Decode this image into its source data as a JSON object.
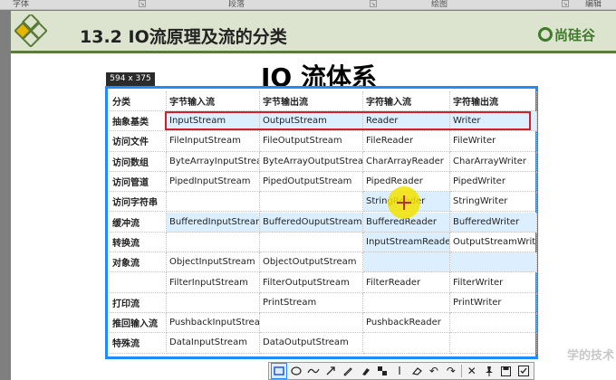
{
  "ribbon": {
    "groups": [
      "字体",
      "段落",
      "绘图",
      "编辑"
    ]
  },
  "slide": {
    "header_title": "13.2 IO流原理及流的分类",
    "brand": "尚硅谷",
    "page_title": "IO 流体系"
  },
  "selection": {
    "size_label": "594 x 375"
  },
  "table": {
    "headers": [
      "分类",
      "字节输入流",
      "字节输出流",
      "字符输入流",
      "字符输出流"
    ],
    "rows": [
      [
        "抽象基类",
        "InputStream",
        "OutputStream",
        "Reader",
        "Writer"
      ],
      [
        "访问文件",
        "FileInputStream",
        "FileOutputStream",
        "FileReader",
        "FileWriter"
      ],
      [
        "访问数组",
        "ByteArrayInputStream",
        "ByteArrayOutputStream",
        "CharArrayReader",
        "CharArrayWriter"
      ],
      [
        "访问管道",
        "PipedInputStream",
        "PipedOutputStream",
        "PipedReader",
        "PipedWriter"
      ],
      [
        "访问字符串",
        "",
        "",
        "StringReader",
        "StringWriter"
      ],
      [
        "缓冲流",
        "BufferedInputStream",
        "BufferedOuputStream",
        "BufferedReader",
        "BufferedWriter"
      ],
      [
        "转换流",
        "",
        "",
        "InputStreamReader",
        "OutputStreamWriter"
      ],
      [
        "对象流",
        "ObjectInputStream",
        "ObjectOutputStream",
        "",
        ""
      ],
      [
        "",
        "FilterInputStream",
        "FilterOutputStream",
        "FilterReader",
        "FilterWriter"
      ],
      [
        "打印流",
        "",
        "PrintStream",
        "",
        "PrintWriter"
      ],
      [
        "推回输入流",
        "PushbackInputStream",
        "",
        "PushbackReader",
        ""
      ],
      [
        "特殊流",
        "DataInputStream",
        "DataOutputStream",
        "",
        ""
      ]
    ]
  },
  "toolbar": {
    "tools": [
      "rectangle-icon",
      "ellipse-icon",
      "curve-icon",
      "arrow-icon",
      "pen-icon",
      "marker-icon",
      "mosaic-icon",
      "text-icon",
      "eraser-icon",
      "undo-icon",
      "redo-icon",
      "close-icon",
      "pin-icon",
      "save-icon",
      "confirm-icon"
    ]
  },
  "watermark": "学的技术",
  "colors": {
    "selection_border": "#1e8cff",
    "highlight_box": "#d0202a",
    "cursor_highlight": "#f2e300",
    "shaded_cell": "#dcefff",
    "brand_green": "#3f7a2a"
  }
}
